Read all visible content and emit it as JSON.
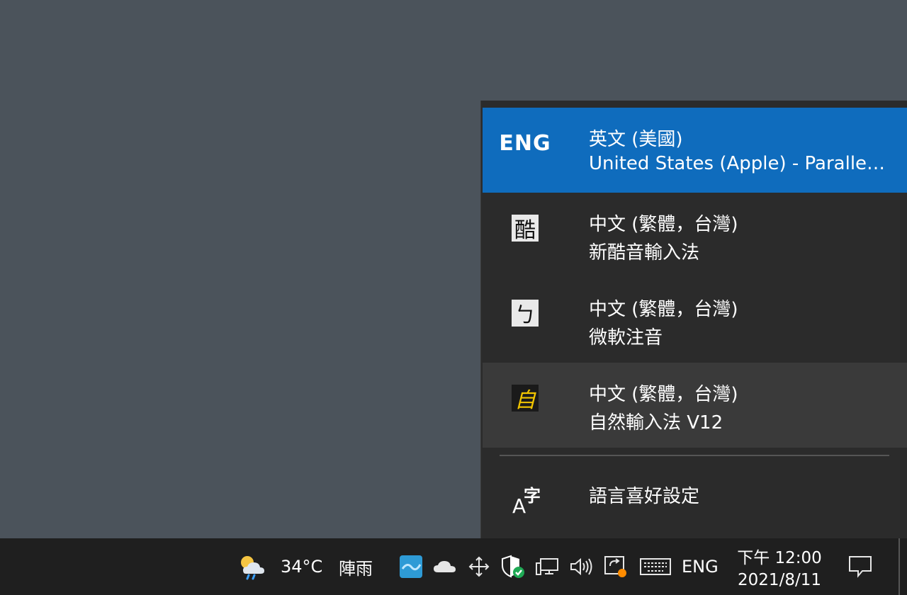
{
  "language_menu": {
    "items": [
      {
        "code": "ENG",
        "language": "英文 (美國)",
        "keyboard": "United States (Apple) - Parallels (Mac)",
        "selected": true
      },
      {
        "icon_char": "酷",
        "language": "中文 (繁體，台灣)",
        "keyboard": "新酷音輸入法"
      },
      {
        "icon_char": "ㄅ",
        "language": "中文 (繁體，台灣)",
        "keyboard": "微軟注音"
      },
      {
        "icon_char": "自",
        "language": "中文 (繁體，台灣)",
        "keyboard": "自然輸入法 V12",
        "hovered": true
      }
    ],
    "preferences": {
      "icon_a": "A",
      "icon_zi": "字",
      "label": "語言喜好設定"
    }
  },
  "taskbar": {
    "weather": {
      "temperature": "34°C",
      "condition": "陣雨"
    },
    "input_indicator": "ENG",
    "clock": {
      "time": "下午 12:00",
      "date": "2021/8/11"
    }
  },
  "colors": {
    "accent": "#0f6cbd",
    "flyout_bg": "#2b2b2b",
    "taskbar_bg": "#1f1f1f",
    "desktop_bg": "#4b535b"
  }
}
